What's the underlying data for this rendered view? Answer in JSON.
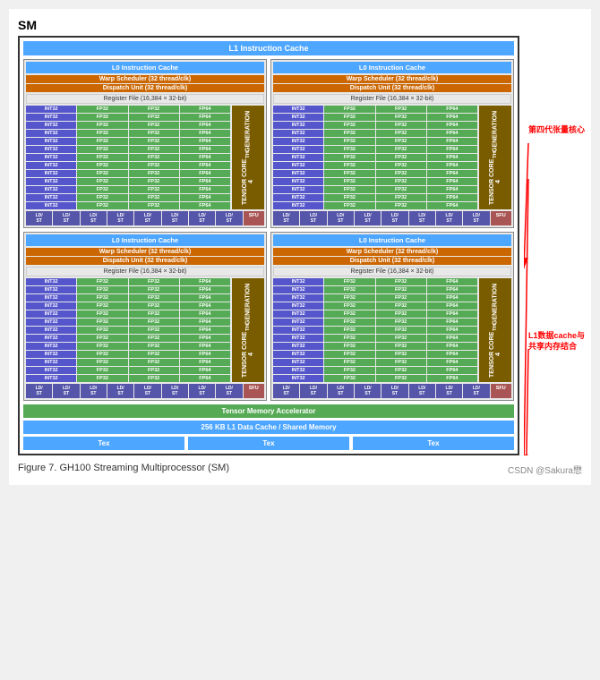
{
  "title": "SM",
  "l1_cache_top": "L1 Instruction Cache",
  "l0_cache": "L0 Instruction Cache",
  "warp_scheduler": "Warp Scheduler (32 thread/clk)",
  "dispatch_unit": "Dispatch Unit (32 thread/clk)",
  "register_file": "Register File (16,384 × 32-bit)",
  "tensor_core_line1": "TENSOR CORE",
  "tensor_core_line2": "4TH GENERATION",
  "sfu_label": "SFU",
  "ld_st_label": "LD/ ST",
  "tensor_memory_acc": "Tensor Memory Accelerator",
  "l1_data_cache": "256 KB L1 Data Cache / Shared Memory",
  "tex_label": "Tex",
  "figure_label": "Figure 7.",
  "figure_caption": "GH100 Streaming Multiprocessor (SM)",
  "csdn_label": "CSDN @Sakura懋",
  "annotation_1": "第四代张量核心",
  "annotation_2": "L1数据cache与\n共享内存结合",
  "reg_types": [
    "INT32",
    "FP32",
    "FP32",
    "FP64"
  ],
  "num_reg_rows": 13
}
